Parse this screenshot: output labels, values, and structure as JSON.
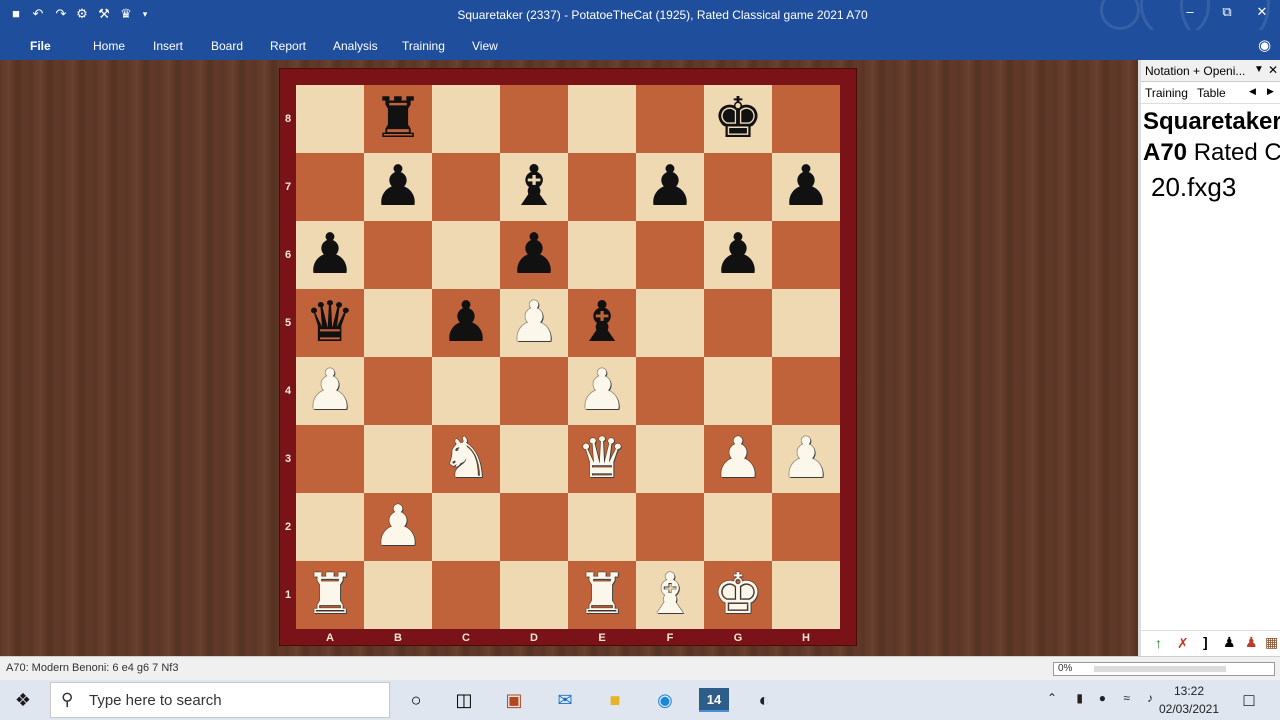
{
  "title_bar": {
    "title": "Squaretaker (2337) - PotatoeTheCat (1925), Rated Classical game 2021  A70",
    "minimize": "–",
    "restore": "⧉",
    "close": "✕"
  },
  "menu": {
    "items": [
      "File",
      "Home",
      "Insert",
      "Board",
      "Report",
      "Analysis",
      "Training",
      "View"
    ]
  },
  "board": {
    "ranks": [
      "8",
      "7",
      "6",
      "5",
      "4",
      "3",
      "2",
      "1"
    ],
    "files": [
      "A",
      "B",
      "C",
      "D",
      "E",
      "F",
      "G",
      "H"
    ],
    "position": [
      [
        "",
        "br",
        "",
        "",
        "",
        "",
        "bk",
        ""
      ],
      [
        "",
        "bp",
        "",
        "bb",
        "",
        "bp",
        "",
        "bp"
      ],
      [
        "bp",
        "",
        "",
        "bp",
        "",
        "",
        "bp",
        ""
      ],
      [
        "bq",
        "",
        "bp",
        "wp",
        "bb",
        "",
        "",
        ""
      ],
      [
        "wp",
        "",
        "",
        "",
        "wp",
        "",
        "",
        ""
      ],
      [
        "",
        "",
        "wn",
        "",
        "wq",
        "",
        "wp",
        "wp"
      ],
      [
        "",
        "wp",
        "",
        "",
        "",
        "",
        "",
        ""
      ],
      [
        "wr",
        "",
        "",
        "",
        "wr",
        "wb",
        "wk",
        ""
      ]
    ]
  },
  "pane": {
    "header_title": "Notation + Openi...",
    "tabs": [
      "Training",
      "Table"
    ],
    "players": "Squaretaker",
    "eco": "A70",
    "event": "Rated Cl",
    "current_move": "20.fxg3"
  },
  "status": {
    "opening": "A70: Modern Benoni: 6 e4 g6 7 Nf3",
    "progress": "0%"
  },
  "taskbar": {
    "search_placeholder": "Type here to search",
    "time": "13:22",
    "date": "02/03/2021",
    "app_badge": "14"
  }
}
